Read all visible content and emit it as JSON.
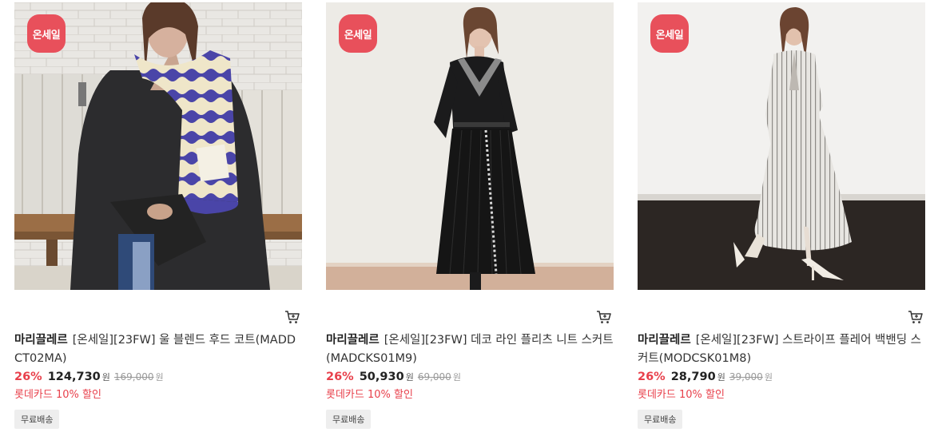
{
  "products": [
    {
      "badge": "온세일",
      "brand": "마리끌레르",
      "name": "[온세일][23FW] 울 블렌드 후드 코트(MADDCT02MA)",
      "discount": "26%",
      "price": "124,730",
      "currency": "원",
      "original_price": "169,000",
      "card_promo": "롯데카드 10% 할인",
      "shipping": "무료배송",
      "image": "woman-in-striped-scarf-and-coat"
    },
    {
      "badge": "온세일",
      "brand": "마리끌레르",
      "name": "[온세일][23FW] 데코 라인 플리츠 니트 스커트(MADCKS01M9)",
      "discount": "26%",
      "price": "50,930",
      "currency": "원",
      "original_price": "69,000",
      "card_promo": "롯데카드 10% 할인",
      "shipping": "무료배송",
      "image": "woman-in-black-pleated-knit-skirt"
    },
    {
      "badge": "온세일",
      "brand": "마리끌레르",
      "name": "[온세일][23FW] 스트라이프 플레어 백밴딩 스커트(MODCSK01M8)",
      "discount": "26%",
      "price": "28,790",
      "currency": "원",
      "original_price": "39,000",
      "card_promo": "롯데카드 10% 할인",
      "shipping": "무료배송",
      "image": "woman-in-striped-flare-skirt"
    }
  ],
  "colors": {
    "badge": "#e8505b",
    "discount": "#e8404b",
    "promo": "#e8404b"
  },
  "icons": {
    "cart": "shopping-cart-icon"
  }
}
